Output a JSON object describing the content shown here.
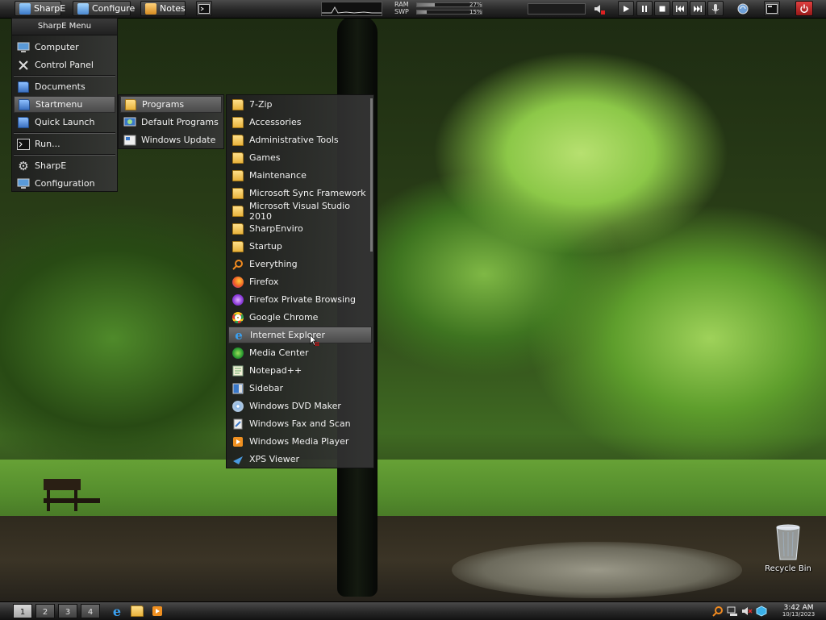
{
  "top_bar": {
    "sharpe_label": "SharpE",
    "configure_label": "Configure",
    "notes_label": "Notes",
    "ram_label": "RAM",
    "swp_label": "SWP",
    "ram_value": "27%",
    "swp_value": "15%",
    "ram_fraction": 0.27,
    "swp_fraction": 0.15
  },
  "main_menu": {
    "header": "SharpE Menu",
    "items": [
      {
        "label": "Computer",
        "icon": "computer-icon"
      },
      {
        "label": "Control Panel",
        "icon": "tools-icon"
      },
      {
        "label": "Documents",
        "icon": "folder-icon"
      },
      {
        "label": "Startmenu",
        "icon": "folder-icon"
      },
      {
        "label": "Quick Launch",
        "icon": "folder-icon"
      },
      {
        "label": "Run...",
        "icon": "run-icon"
      },
      {
        "label": "SharpE",
        "icon": "gear-icon"
      },
      {
        "label": "Configuration",
        "icon": "configuration-icon"
      }
    ]
  },
  "start_submenu": {
    "items": [
      {
        "label": "Programs",
        "icon": "folder-icon"
      },
      {
        "label": "Default Programs",
        "icon": "default-programs-icon"
      },
      {
        "label": "Windows Update",
        "icon": "windows-update-icon"
      }
    ]
  },
  "programs_menu": {
    "items": [
      {
        "label": "7-Zip",
        "icon": "folder-icon"
      },
      {
        "label": "Accessories",
        "icon": "folder-icon"
      },
      {
        "label": "Administrative Tools",
        "icon": "folder-icon"
      },
      {
        "label": "Games",
        "icon": "folder-icon"
      },
      {
        "label": "Maintenance",
        "icon": "folder-icon"
      },
      {
        "label": "Microsoft Sync Framework",
        "icon": "folder-icon"
      },
      {
        "label": "Microsoft Visual Studio 2010",
        "icon": "folder-icon"
      },
      {
        "label": "SharpEnviro",
        "icon": "folder-icon"
      },
      {
        "label": "Startup",
        "icon": "folder-icon"
      },
      {
        "label": "Everything",
        "icon": "search-icon"
      },
      {
        "label": "Firefox",
        "icon": "firefox-icon"
      },
      {
        "label": "Firefox Private Browsing",
        "icon": "firefox-private-icon"
      },
      {
        "label": "Google Chrome",
        "icon": "chrome-icon"
      },
      {
        "label": "Internet Explorer",
        "icon": "internet-explorer-icon"
      },
      {
        "label": "Media Center",
        "icon": "media-center-icon"
      },
      {
        "label": "Notepad++",
        "icon": "notepad-icon"
      },
      {
        "label": "Sidebar",
        "icon": "sidebar-icon"
      },
      {
        "label": "Windows DVD Maker",
        "icon": "dvd-icon"
      },
      {
        "label": "Windows Fax and Scan",
        "icon": "fax-icon"
      },
      {
        "label": "Windows Media Player",
        "icon": "media-player-icon"
      },
      {
        "label": "XPS Viewer",
        "icon": "xps-icon"
      }
    ]
  },
  "desktop": {
    "recycle_bin_label": "Recycle Bin"
  },
  "taskbar": {
    "workspaces": [
      "1",
      "2",
      "3",
      "4"
    ],
    "clock_time": "3:42 AM",
    "clock_date": "10/13/2023"
  },
  "colors": {
    "panel_dark": "#1e1e1e",
    "highlight": "#5c5c5c",
    "folder": "#f0c050",
    "power": "#cc2222"
  }
}
